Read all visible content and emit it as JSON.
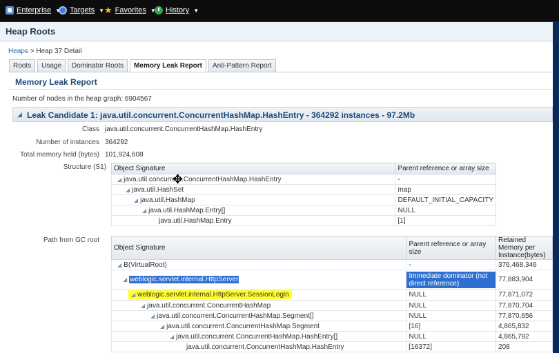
{
  "topnav": {
    "items": [
      {
        "label": "Enterprise",
        "icon": "enterprise-icon"
      },
      {
        "label": "Targets",
        "icon": "targets-icon"
      },
      {
        "label": "Favorites",
        "icon": "star-icon"
      },
      {
        "label": "History",
        "icon": "history-icon"
      }
    ]
  },
  "page": {
    "title": "Heap Roots"
  },
  "breadcrumb": {
    "link": "Heaps",
    "sep": ">",
    "current": "Heap 37 Detail"
  },
  "tabs": [
    "Roots",
    "Usage",
    "Dominator Roots",
    "Memory Leak Report",
    "Anti-Pattern Report"
  ],
  "report": {
    "title": "Memory Leak Report",
    "nodes_label": "Number of nodes in the heap graph:",
    "nodes_value": "6904567"
  },
  "leak": {
    "header": "Leak Candidate 1: java.util.concurrent.ConcurrentHashMap.HashEntry - 364292 instances - 97.2Mb",
    "fields": [
      {
        "label": "Class",
        "value": "java.util.concurrent.ConcurrentHashMap.HashEntry"
      },
      {
        "label": "Number of instances",
        "value": "364292"
      },
      {
        "label": "Total memory held (bytes)",
        "value": "101,924,608"
      }
    ],
    "structure_label": "Structure (S1)",
    "structure_cols": [
      "Object Signature",
      "Parent reference or array size"
    ],
    "structure_rows": [
      {
        "sig": "java.util.concurrent.ConcurrentHashMap.HashEntry",
        "parent": "-"
      },
      {
        "sig": "java.util.HashSet",
        "parent": "map"
      },
      {
        "sig": "java.util.HashMap",
        "parent": "DEFAULT_INITIAL_CAPACITY"
      },
      {
        "sig": "java.util.HashMap.Entry[]",
        "parent": "NULL"
      },
      {
        "sig": "java.util.HashMap.Entry",
        "parent": "[1]"
      }
    ],
    "path_label": "Path from GC root",
    "path_cols": [
      "Object Signature",
      "Parent reference or array size",
      "Retained Memory per Instance(bytes)"
    ],
    "path_rows": [
      {
        "sig": "B(VirtualRoot)",
        "parent": "-",
        "mem": "376,468,346"
      },
      {
        "sig": "weblogic.servlet.internal.HttpServer",
        "parent": "Immediate dominator (not direct reference)",
        "mem": "77,883,904"
      },
      {
        "sig": "weblogic.servlet.internal.HttpServer.SessionLogin",
        "parent": "NULL",
        "mem": "77,871,072"
      },
      {
        "sig": "java.util.concurrent.ConcurrentHashMap",
        "parent": "NULL",
        "mem": "77,870,704"
      },
      {
        "sig": "java.util.concurrent.ConcurrentHashMap.Segment[]",
        "parent": "NULL",
        "mem": "77,870,656"
      },
      {
        "sig": "java.util.concurrent.ConcurrentHashMap.Segment",
        "parent": "[16]",
        "mem": "4,865,832"
      },
      {
        "sig": "java.util.concurrent.ConcurrentHashMap.HashEntry[]",
        "parent": "NULL",
        "mem": "4,865,792"
      },
      {
        "sig": "java.util.concurrent.ConcurrentHashMap.HashEntry",
        "parent": "[16372]",
        "mem": "208"
      }
    ]
  },
  "colors": {
    "topbar": "#0d0d0d",
    "right_bar": "#0a2a5c",
    "highlight_yellow": "#ffff2a",
    "selection_blue": "#2d6fd1"
  }
}
